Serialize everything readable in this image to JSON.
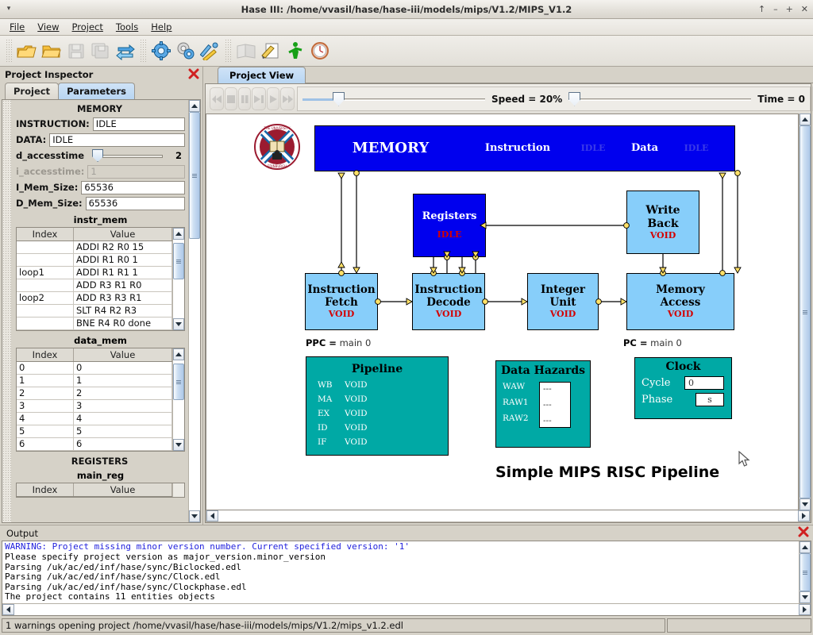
{
  "window": {
    "title": "Hase III: /home/vvasil/hase/hase-iii/models/mips/V1.2/MIPS_V1.2",
    "menu_arrow": "▾",
    "buttons": {
      "shade": "↑",
      "minimize": "–",
      "maximize": "+",
      "close": "✕"
    }
  },
  "menubar": [
    {
      "label": "File",
      "mnemonic": "F"
    },
    {
      "label": "View",
      "mnemonic": "V"
    },
    {
      "label": "Project",
      "mnemonic": "P"
    },
    {
      "label": "Tools",
      "mnemonic": "T"
    },
    {
      "label": "Help",
      "mnemonic": "H"
    }
  ],
  "toolbar": [
    {
      "name": "open-project-icon",
      "label": "Open Project",
      "enabled": true
    },
    {
      "name": "open-folder-icon",
      "label": "Open",
      "enabled": true
    },
    {
      "name": "save-icon",
      "label": "Save",
      "enabled": false
    },
    {
      "name": "save-all-icon",
      "label": "Save All",
      "enabled": false
    },
    {
      "name": "refresh-icon",
      "label": "Reload",
      "enabled": true
    },
    {
      "name": "gear-icon",
      "label": "Build",
      "enabled": true
    },
    {
      "name": "gears-icon",
      "label": "Rebuild",
      "enabled": true
    },
    {
      "name": "tools-icon",
      "label": "Preferences",
      "enabled": true
    },
    {
      "name": "book-icon",
      "label": "Library",
      "enabled": false
    },
    {
      "name": "edit-document-icon",
      "label": "Edit",
      "enabled": true
    },
    {
      "name": "run-icon",
      "label": "Run",
      "enabled": true
    },
    {
      "name": "clock-icon",
      "label": "Timing",
      "enabled": true
    }
  ],
  "inspector": {
    "title": "Project Inspector",
    "close_icon": "close-icon",
    "tabs": [
      {
        "label": "Project",
        "active": false
      },
      {
        "label": "Parameters",
        "active": true
      }
    ],
    "memory": {
      "section_title": "MEMORY",
      "instruction_label": "INSTRUCTION:",
      "instruction_value": "IDLE",
      "data_label": "DATA:",
      "data_value": "IDLE",
      "d_accesstime_label": "d_accesstime",
      "d_accesstime_value": "2",
      "i_accesstime_label": "i_accesstime:",
      "i_accesstime_value": "1",
      "i_mem_size_label": "I_Mem_Size:",
      "i_mem_size_value": "65536",
      "d_mem_size_label": "D_Mem_Size:",
      "d_mem_size_value": "65536"
    },
    "instr_mem": {
      "title": "instr_mem",
      "columns": [
        "Index",
        "Value"
      ],
      "rows": [
        {
          "index": "",
          "value": "ADDI R2 R0 15"
        },
        {
          "index": "",
          "value": "ADDI R1 R0 1"
        },
        {
          "index": "loop1",
          "value": "ADDI R1 R1 1"
        },
        {
          "index": "",
          "value": "ADD R3 R1 R0"
        },
        {
          "index": "loop2",
          "value": "ADD R3 R3 R1"
        },
        {
          "index": "",
          "value": "SLT R4 R2 R3"
        },
        {
          "index": "",
          "value": "BNE R4 R0 done"
        }
      ]
    },
    "data_mem": {
      "title": "data_mem",
      "columns": [
        "Index",
        "Value"
      ],
      "rows": [
        {
          "index": "0",
          "value": "0"
        },
        {
          "index": "1",
          "value": "1"
        },
        {
          "index": "2",
          "value": "2"
        },
        {
          "index": "3",
          "value": "3"
        },
        {
          "index": "4",
          "value": "4"
        },
        {
          "index": "5",
          "value": "5"
        },
        {
          "index": "6",
          "value": "6"
        }
      ]
    },
    "registers": {
      "section_title": "REGISTERS",
      "title": "main_reg",
      "columns": [
        "Index",
        "Value"
      ]
    }
  },
  "project_view": {
    "tab_label": "Project View",
    "sim_buttons": [
      {
        "name": "rewind-button",
        "glyph": "rewind"
      },
      {
        "name": "stop-button",
        "glyph": "stop"
      },
      {
        "name": "pause-button",
        "glyph": "pause"
      },
      {
        "name": "step-button",
        "glyph": "step"
      },
      {
        "name": "play-button",
        "glyph": "play"
      },
      {
        "name": "fast-forward-button",
        "glyph": "ffwd"
      }
    ],
    "speed_label": "Speed = 20%",
    "speed_percent": 20,
    "time_label": "Time = 0",
    "time_value": 0,
    "window_icon": "new-window-icon"
  },
  "diagram": {
    "title": "Simple MIPS RISC Pipeline",
    "crest_alt": "University of Edinburgh crest",
    "memory_block": {
      "name": "MEMORY",
      "instruction_label": "Instruction",
      "instruction_state": "IDLE",
      "data_label": "Data",
      "data_state": "IDLE",
      "color": "#0000ee",
      "text_color": "#ffffff"
    },
    "registers_block": {
      "name": "Registers",
      "state": "IDLE",
      "color": "#0000ee",
      "text_color": "#ffffff"
    },
    "stages": [
      {
        "line1": "Instruction",
        "line2": "Fetch",
        "state": "VOID"
      },
      {
        "line1": "Instruction",
        "line2": "Decode",
        "state": "VOID"
      },
      {
        "line1": "Integer",
        "line2": "Unit",
        "state": "VOID"
      },
      {
        "line1": "Memory",
        "line2": "Access",
        "state": "VOID"
      }
    ],
    "write_back": {
      "line1": "Write",
      "line2": "Back",
      "state": "VOID"
    },
    "block_color": "#87cefa",
    "state_color": "#d40000",
    "ppc": {
      "label": "PPC =",
      "value": "main 0"
    },
    "pc": {
      "label": "PC =",
      "value": "main 0"
    },
    "pipeline": {
      "title": "Pipeline",
      "color": "#00a9a5",
      "rows": [
        {
          "stage": "WB",
          "value": "VOID"
        },
        {
          "stage": "MA",
          "value": "VOID"
        },
        {
          "stage": "EX",
          "value": "VOID"
        },
        {
          "stage": "ID",
          "value": "VOID"
        },
        {
          "stage": "IF",
          "value": "VOID"
        }
      ]
    },
    "data_hazards": {
      "title": "Data Hazards",
      "color": "#00a9a5",
      "rows": [
        {
          "name": "WAW",
          "value": "---"
        },
        {
          "name": "RAW1",
          "value": "---"
        },
        {
          "name": "RAW2",
          "value": "---"
        }
      ]
    },
    "clock": {
      "title": "Clock",
      "color": "#00a9a5",
      "cycle_label": "Cycle",
      "cycle_value": "0",
      "phase_label": "Phase",
      "phase_value": "s"
    }
  },
  "output": {
    "title": "Output",
    "close_icon": "close-icon",
    "lines": [
      {
        "text": "WARNING: Project missing minor version number. Current specified version: '1'",
        "warning": true
      },
      {
        "text": "Please specify project version as major_version.minor_version",
        "warning": false
      },
      {
        "text": "Parsing /uk/ac/ed/inf/hase/sync/Biclocked.edl",
        "warning": false
      },
      {
        "text": "Parsing /uk/ac/ed/inf/hase/sync/Clock.edl",
        "warning": false
      },
      {
        "text": "Parsing /uk/ac/ed/inf/hase/sync/Clockphase.edl",
        "warning": false
      },
      {
        "text": "The project contains 11 entities objects",
        "warning": false
      }
    ]
  },
  "statusbar": {
    "message": "1 warnings opening project /home/vvasil/hase/hase-iii/models/mips/V1.2/mips_v1.2.edl"
  }
}
